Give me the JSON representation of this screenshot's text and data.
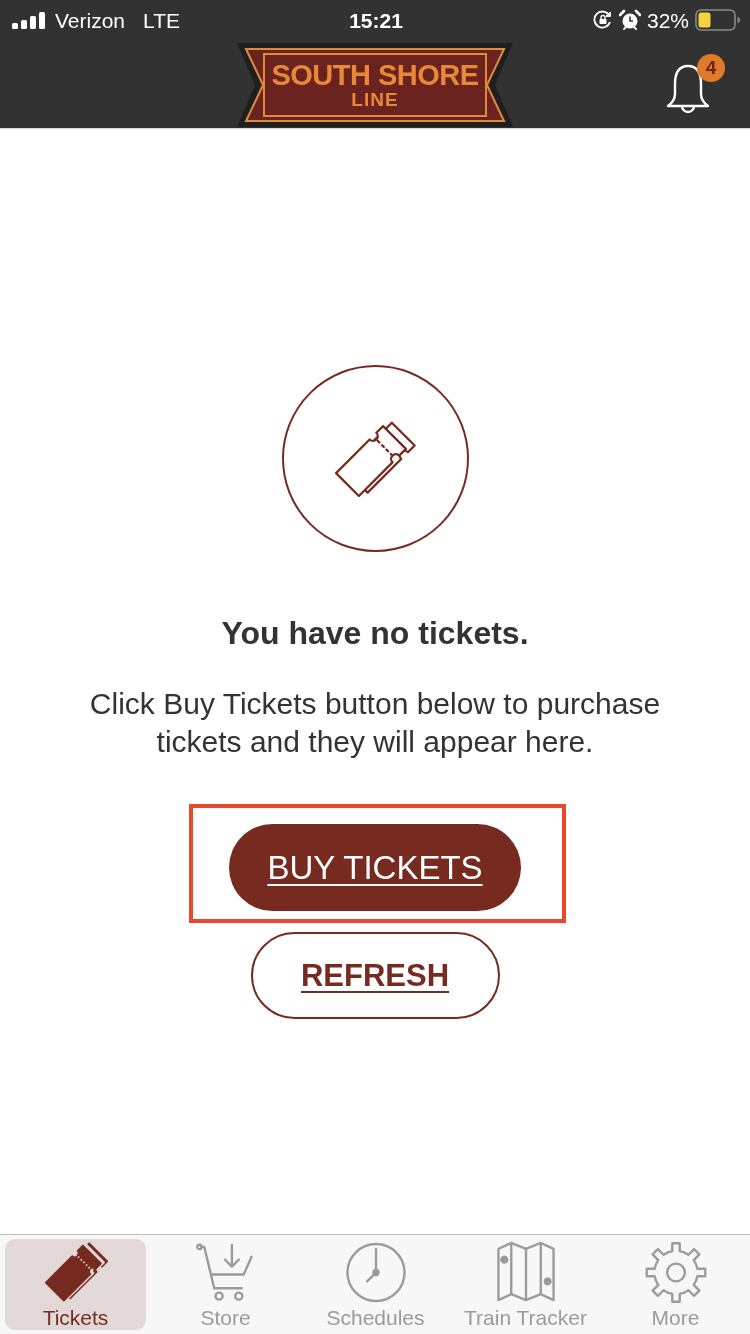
{
  "status_bar": {
    "carrier": "Verizon",
    "network": "LTE",
    "time": "15:21",
    "battery": "32%"
  },
  "header": {
    "logo": {
      "line_1": "SOUTH SHORE",
      "line_2": "LINE"
    },
    "notifications": {
      "count": "4"
    }
  },
  "empty_state": {
    "title": "You have no tickets.",
    "message": "Click Buy Tickets button below to purchase tickets and they will appear here."
  },
  "buttons": [
    {
      "label": "BUY TICKETS",
      "kind": "primary",
      "highlighted": true
    },
    {
      "label": "REFRESH",
      "kind": "secondary",
      "highlighted": false
    }
  ],
  "tab_bar": [
    {
      "label": "Tickets",
      "selected": true
    },
    {
      "label": "Store",
      "selected": false
    },
    {
      "label": "Schedules",
      "selected": false
    },
    {
      "label": "Train Tracker",
      "selected": false
    },
    {
      "label": "More",
      "selected": false
    }
  ]
}
